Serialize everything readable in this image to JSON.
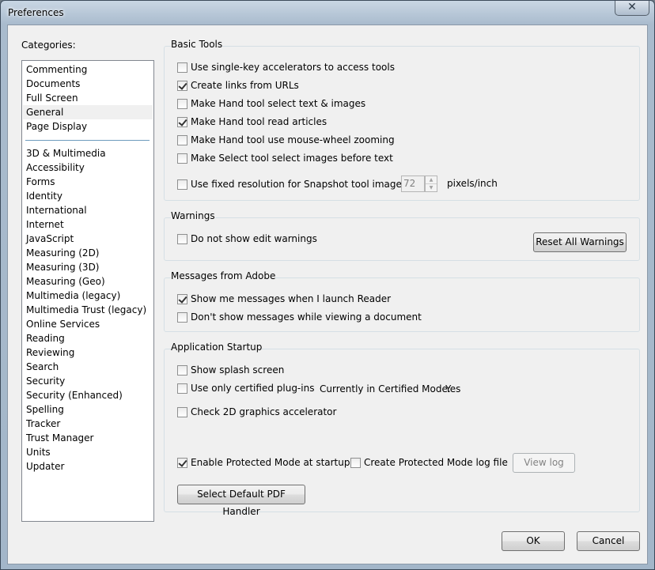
{
  "window": {
    "title": "Preferences",
    "close_glyph": "✕"
  },
  "categories": {
    "label": "Categories:",
    "primary": [
      "Commenting",
      "Documents",
      "Full Screen",
      "General",
      "Page Display"
    ],
    "selected": "General",
    "secondary": [
      "3D & Multimedia",
      "Accessibility",
      "Forms",
      "Identity",
      "International",
      "Internet",
      "JavaScript",
      "Measuring (2D)",
      "Measuring (3D)",
      "Measuring (Geo)",
      "Multimedia (legacy)",
      "Multimedia Trust (legacy)",
      "Online Services",
      "Reading",
      "Reviewing",
      "Search",
      "Security",
      "Security (Enhanced)",
      "Spelling",
      "Tracker",
      "Trust Manager",
      "Units",
      "Updater"
    ]
  },
  "basic_tools": {
    "title": "Basic Tools",
    "options": [
      {
        "label": "Use single-key accelerators to access tools",
        "checked": false
      },
      {
        "label": "Create links from URLs",
        "checked": true
      },
      {
        "label": "Make Hand tool select text & images",
        "checked": false
      },
      {
        "label": "Make Hand tool read articles",
        "checked": true
      },
      {
        "label": "Make Hand tool use mouse-wheel zooming",
        "checked": false
      },
      {
        "label": "Make Select tool select images before text",
        "checked": false
      },
      {
        "label": "Use fixed resolution for Snapshot tool images:",
        "checked": false
      }
    ],
    "snapshot_resolution": "72",
    "snapshot_unit": "pixels/inch"
  },
  "warnings": {
    "title": "Warnings",
    "option": {
      "label": "Do not show edit warnings",
      "checked": false
    },
    "reset_button": "Reset All Warnings"
  },
  "messages": {
    "title": "Messages from Adobe",
    "options": [
      {
        "label": "Show me messages when I launch Reader",
        "checked": true
      },
      {
        "label": "Don't show messages while viewing a document",
        "checked": false
      }
    ]
  },
  "startup": {
    "title": "Application Startup",
    "splash": {
      "label": "Show splash screen",
      "checked": false
    },
    "certified": {
      "label": "Use only certified plug-ins",
      "checked": false
    },
    "certified_mode_label": "Currently in Certified Mode:",
    "certified_mode_value": "Yes",
    "graphics": {
      "label": "Check 2D graphics accelerator",
      "checked": false
    },
    "protected_mode": {
      "label": "Enable Protected Mode at startup",
      "checked": true
    },
    "protected_log": {
      "label": "Create Protected Mode log file",
      "checked": false
    },
    "view_log_button": "View log",
    "default_handler_button": "Select Default PDF Handler"
  },
  "footer": {
    "ok": "OK",
    "cancel": "Cancel"
  }
}
